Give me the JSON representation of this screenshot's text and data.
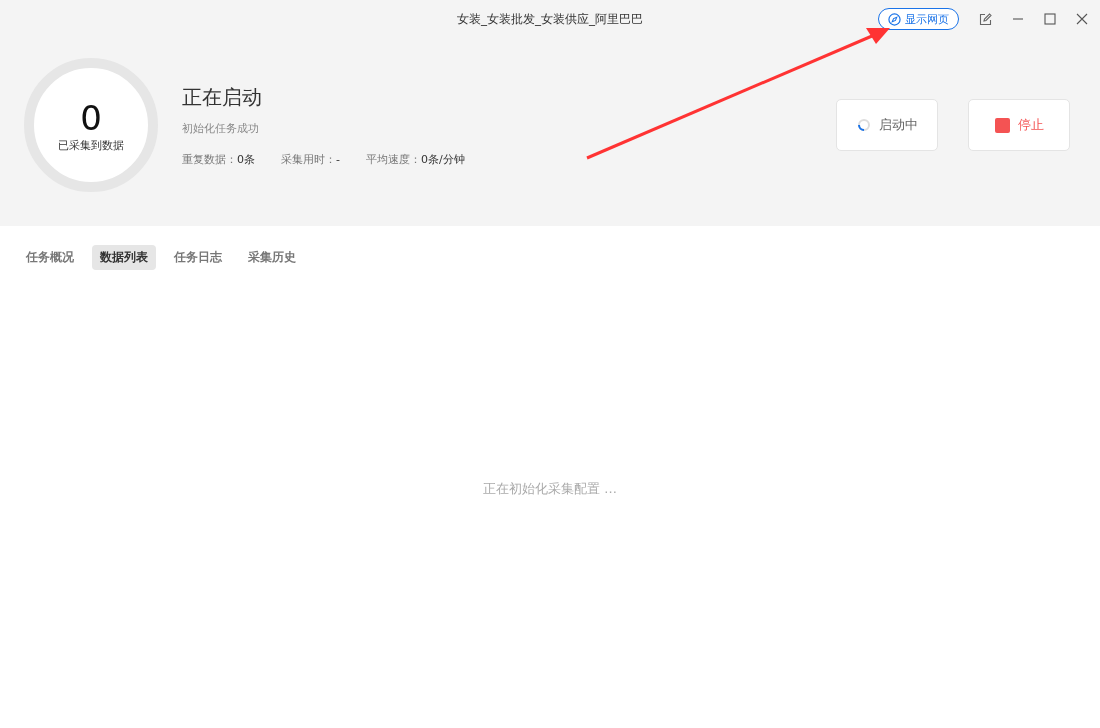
{
  "window": {
    "title": "女装_女装批发_女装供应_阿里巴巴",
    "show_page_button": "显示网页"
  },
  "summary": {
    "count": "0",
    "count_label": "已采集到数据",
    "status": "正在启动",
    "message": "初始化任务成功",
    "stats": [
      {
        "label": "重复数据：",
        "value": "0条"
      },
      {
        "label": "采集用时：",
        "value": "-"
      },
      {
        "label": "平均速度：",
        "value": "0条/分钟"
      }
    ],
    "buttons": [
      {
        "kind": "loading",
        "label": "启动中"
      },
      {
        "kind": "stop",
        "label": "停止"
      }
    ]
  },
  "tabs": [
    {
      "label": "任务概况",
      "selected": false
    },
    {
      "label": "数据列表",
      "selected": true
    },
    {
      "label": "任务日志",
      "selected": false
    },
    {
      "label": "采集历史",
      "selected": false
    }
  ],
  "empty_message": "正在初始化采集配置 ..."
}
